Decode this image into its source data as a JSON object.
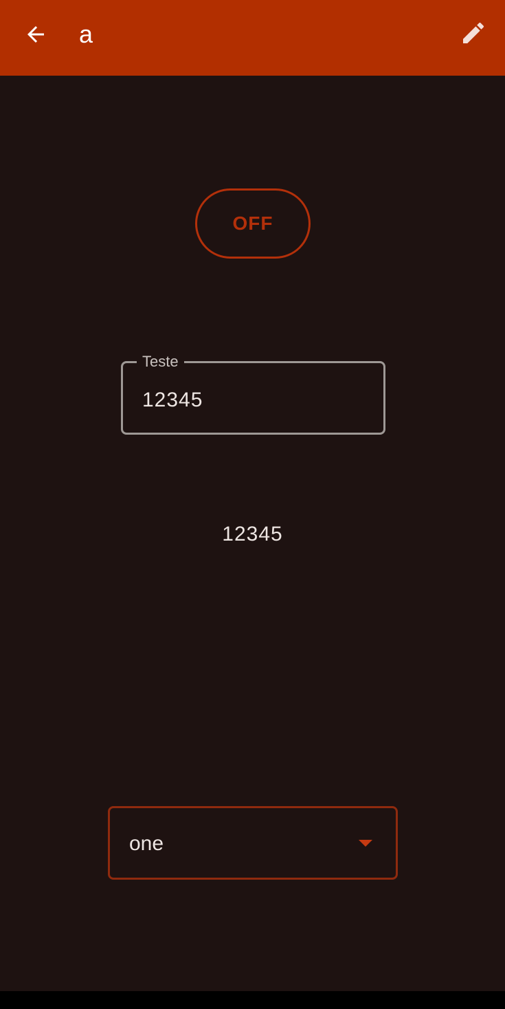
{
  "colors": {
    "appbar": "#b22f00",
    "background": "#1e1211",
    "accent": "#b3300a",
    "text": "#eee6e3",
    "field_border": "#9e9895"
  },
  "appbar": {
    "title": "a",
    "back_icon": "arrow-back-icon",
    "edit_icon": "pencil-edit-icon"
  },
  "toggle": {
    "label": "OFF"
  },
  "text_field": {
    "label": "Teste",
    "value": "12345"
  },
  "display": {
    "text": "12345"
  },
  "dropdown": {
    "selected": "one",
    "arrow_icon": "arrow-drop-down-icon"
  }
}
